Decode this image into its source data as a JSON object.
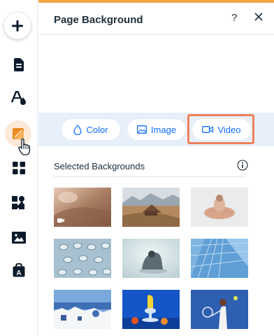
{
  "panel": {
    "title": "Page Background",
    "help_label": "?"
  },
  "tabs": [
    {
      "label": "Color"
    },
    {
      "label": "Image"
    },
    {
      "label": "Video"
    }
  ],
  "selected_backgrounds": {
    "label": "Selected Backgrounds",
    "thumbnails": [
      {
        "name": "thumbnail-1",
        "icon": "video-badge-icon"
      },
      {
        "name": "thumbnail-2"
      },
      {
        "name": "thumbnail-3"
      },
      {
        "name": "thumbnail-4"
      },
      {
        "name": "thumbnail-5"
      },
      {
        "name": "thumbnail-6"
      },
      {
        "name": "thumbnail-7"
      },
      {
        "name": "thumbnail-8"
      },
      {
        "name": "thumbnail-9"
      }
    ]
  },
  "colors": {
    "accent": "#116dff",
    "top_bar": "#f2a745",
    "tab_strip": "#e7f0fa",
    "highlight": "#f07f5c",
    "rail_active": "#fde9d7"
  }
}
